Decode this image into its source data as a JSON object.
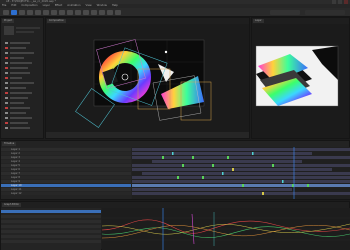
{
  "window": {
    "title": "AE - E:\\PROJECTS\\..._ae_cc_2020.aep *"
  },
  "menu": [
    "File",
    "Edit",
    "Composition",
    "Layer",
    "Effect",
    "Animation",
    "View",
    "Window",
    "Help"
  ],
  "toolbar": {
    "icons": [
      "home-icon",
      "selection-tool-icon",
      "hand-tool-icon",
      "zoom-tool-icon",
      "rotate-tool-icon",
      "camera-tool-icon",
      "pan-behind-icon",
      "rectangle-tool-icon",
      "pen-tool-icon",
      "type-tool-icon",
      "brush-tool-icon",
      "clone-stamp-icon",
      "eraser-icon",
      "roto-brush-icon",
      "puppet-pin-icon"
    ],
    "accent": "#2d6fd0"
  },
  "panels": {
    "left_tabs": [
      "Project",
      "Effect Controls"
    ],
    "viewer_tab": "Composition",
    "viewer2_tab": "Layer",
    "timeline_tab": "Timeline",
    "graph_tab": "Graph Editor"
  },
  "timeline": {
    "layers": [
      "Layer 1",
      "Layer 2",
      "Layer 3",
      "Layer 4",
      "Layer 5",
      "Layer 6",
      "Layer 7",
      "Layer 8",
      "Layer 9",
      "Layer 10",
      "Layer 11",
      "Layer 12"
    ],
    "colors": {
      "selected": "#3a6fb8",
      "keyframe": "#5ad35a",
      "bar": "#4a4a6a",
      "playhead": "#3a8bff"
    }
  },
  "graph_editor": {
    "colors": {
      "curve_red": "#e04545",
      "curve_green": "#46c46a",
      "curve_yellow": "#d6c84a",
      "curve_orange": "#e0923a"
    }
  }
}
